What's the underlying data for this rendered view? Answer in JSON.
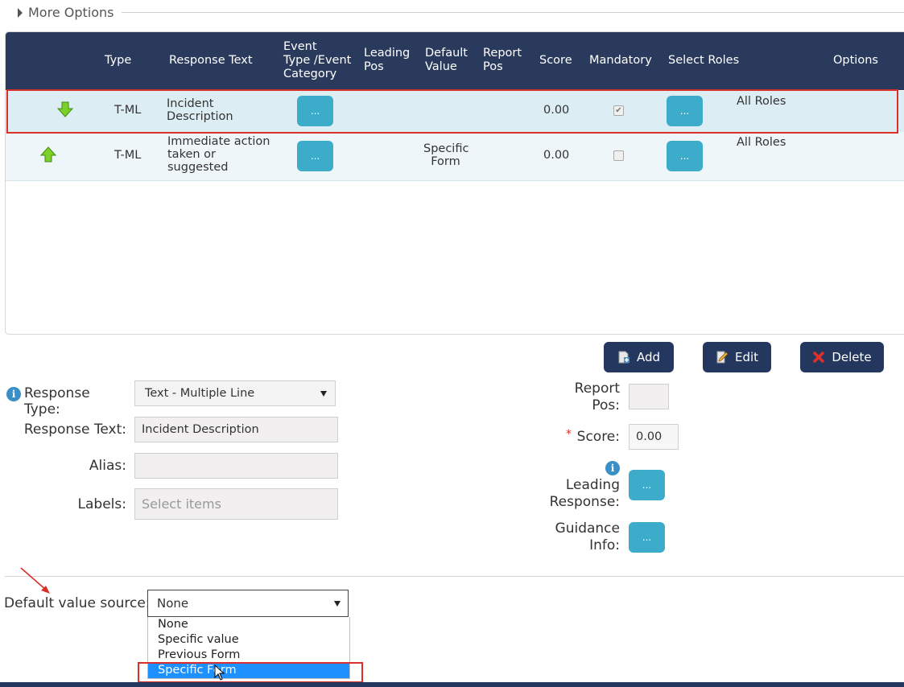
{
  "more_options": {
    "label": "More Options"
  },
  "grid": {
    "headers": {
      "type": "Type",
      "response_text": "Response Text",
      "event_type_line1": "Event",
      "event_type_line2": "Type /Event",
      "event_type_line3": "Category",
      "leading_line1": "Leading",
      "leading_line2": "Pos",
      "default_line1": "Default",
      "default_line2": "Value",
      "report_line1": "Report",
      "report_line2": "Pos",
      "score": "Score",
      "mandatory": "Mandatory",
      "select_roles": "Select Roles",
      "options": "Options"
    },
    "rows": [
      {
        "arrow": "arrow-down-icon",
        "type": "T-ML",
        "response_line1": "Incident",
        "response_line2": "Description",
        "event_btn": "...",
        "default_line1": "",
        "default_line2": "",
        "score": "0.00",
        "mandatory": true,
        "roles_btn": "...",
        "roles": "All Roles"
      },
      {
        "arrow": "arrow-up-icon",
        "type": "T-ML",
        "response_line1": "Immediate action",
        "response_line2": "taken or",
        "response_line3": "suggested",
        "event_btn": "...",
        "default_line1": "Specific",
        "default_line2": "Form",
        "score": "0.00",
        "mandatory": false,
        "roles_btn": "...",
        "roles": "All Roles"
      }
    ]
  },
  "actions": {
    "add": "Add",
    "edit": "Edit",
    "delete": "Delete"
  },
  "form": {
    "response_type_label": "Response Type:",
    "response_type_value": "Text - Multiple Line",
    "response_text_label": "Response Text:",
    "response_text_value": "Incident Description",
    "alias_label": "Alias:",
    "alias_value": "",
    "labels_label": "Labels:",
    "labels_placeholder": "Select items",
    "report_pos_line1": "Report",
    "report_pos_line2": "Pos:",
    "report_pos_value": "",
    "score_label": "Score:",
    "score_required": "*",
    "score_value": "0.00",
    "leading_line1": "Leading",
    "leading_line2": "Response:",
    "leading_btn": "...",
    "guidance_line1": "Guidance",
    "guidance_line2": "Info:",
    "guidance_btn": "..."
  },
  "default_source": {
    "label": "Default value source:",
    "selected": "None",
    "options": [
      "None",
      "Specific value",
      "Previous Form",
      "Specific Form"
    ],
    "highlighted_option": "Specific Form"
  },
  "colors": {
    "header_bg": "#2a3a5c",
    "teal_button": "#3daccb",
    "action_button": "#24375f",
    "highlight_red": "#d9312a",
    "select_blue": "#1e90ff"
  }
}
